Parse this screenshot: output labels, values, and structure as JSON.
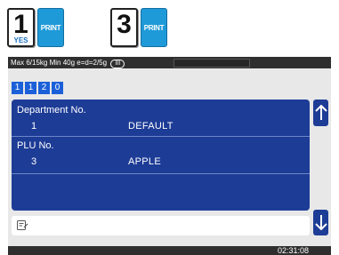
{
  "key_sequence": [
    {
      "digit": "1",
      "sub": "YES"
    },
    {
      "print": "PRINT"
    },
    {
      "digit": "3",
      "sub": ""
    },
    {
      "print": "PRINT"
    }
  ],
  "status": {
    "capacity": "Max 6/15kg Min 40g e=d=2/5g",
    "class_mark": "III"
  },
  "entry_digits": [
    "1",
    "1",
    "2",
    "0"
  ],
  "panel": {
    "rows": [
      {
        "label": "Department No.",
        "num": "1",
        "name": "DEFAULT"
      },
      {
        "label": "PLU No.",
        "num": "3",
        "name": "APPLE"
      }
    ]
  },
  "nav": {
    "up_icon": "arrow-up-icon",
    "down_icon": "arrow-down-icon"
  },
  "message_icon": "edit-note-icon",
  "clock": "02:31:08",
  "colors": {
    "panel_blue": "#1d3c96",
    "digit_blue": "#1b60d8",
    "print_key": "#1f9ad8",
    "status_bar": "#2f2f2f"
  }
}
